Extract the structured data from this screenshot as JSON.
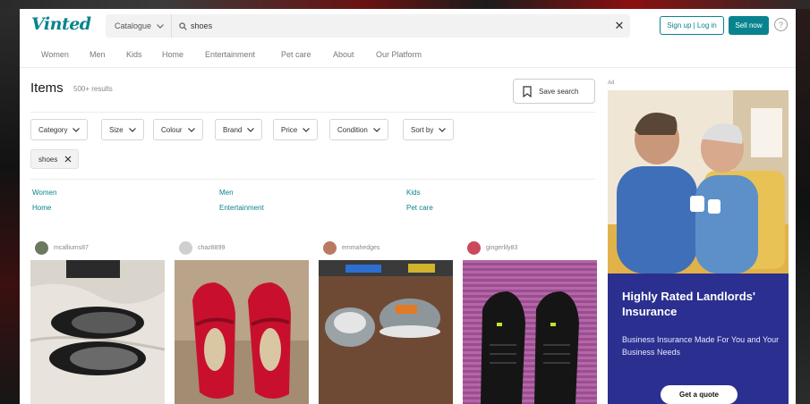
{
  "header": {
    "logo": "Vinted",
    "catalog_label": "Catalogue",
    "search_value": "shoes",
    "clear_label": "✕",
    "signup_label": "Sign up | Log in",
    "sell_label": "Sell now",
    "help_label": "?"
  },
  "nav": [
    "Women",
    "Men",
    "Kids",
    "Home",
    "Entertainment",
    "Pet care",
    "About",
    "Our Platform"
  ],
  "results": {
    "title": "Items",
    "count": "500+ results",
    "save_search_label": "Save search"
  },
  "filters": [
    "Category",
    "Size",
    "Colour",
    "Brand",
    "Price",
    "Condition",
    "Sort by"
  ],
  "active_chip": "shoes",
  "categories": [
    "Women",
    "Men",
    "Kids",
    "Home",
    "Entertainment",
    "Pet care"
  ],
  "products": [
    {
      "seller": "mcalliums87",
      "avatar_color": "#6b7a5e"
    },
    {
      "seller": "chaz8899",
      "avatar_color": "#cfcfcf"
    },
    {
      "seller": "emmahedges",
      "avatar_color": "#b97a62"
    },
    {
      "seller": "gingerlily83",
      "avatar_color": "#c94a5a"
    }
  ],
  "ad": {
    "label": "Ad",
    "title": "Highly Rated Landlords' Insurance",
    "body": "Business Insurance Made For You and Your Business Needs",
    "cta": "Get a quote",
    "background": "#2b2f8f"
  },
  "colors": {
    "brand": "#09848f"
  }
}
